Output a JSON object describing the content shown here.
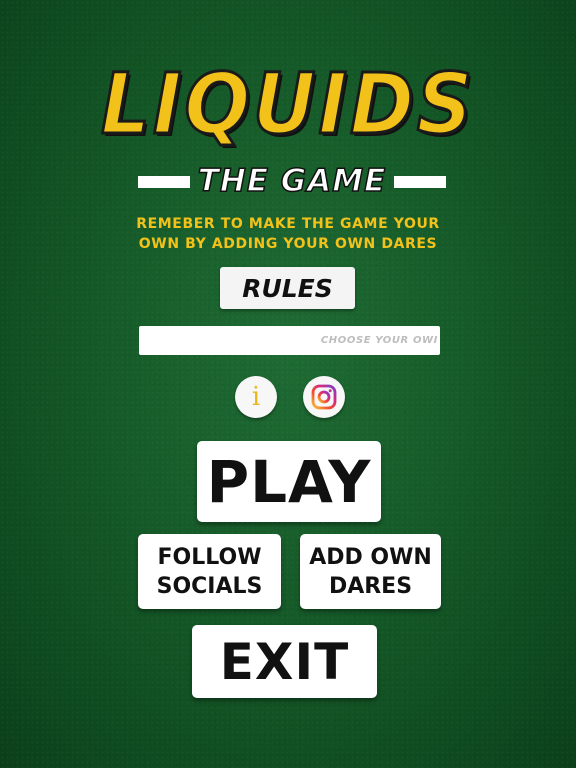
{
  "title": "LIQUIDS",
  "subtitle": "THE GAME",
  "tagline": {
    "line1": "REMEBER TO MAKE THE GAME YOUR",
    "line2": "OWN BY ADDING YOUR OWN DARES"
  },
  "rules_label": "RULES",
  "dare_input": {
    "placeholder": "CHOOSE YOUR OWI",
    "value": ""
  },
  "icons": {
    "info": "info-icon",
    "instagram": "instagram-icon"
  },
  "buttons": {
    "play": "PLAY",
    "follow_line1": "FOLLOW",
    "follow_line2": "SOCIALS",
    "add_line1": "ADD OWN",
    "add_line2": "DARES",
    "exit": "EXIT"
  },
  "colors": {
    "background": "#155a28",
    "accent_yellow": "#f2c21b",
    "button_bg": "#ffffff",
    "text_dark": "#111111"
  }
}
